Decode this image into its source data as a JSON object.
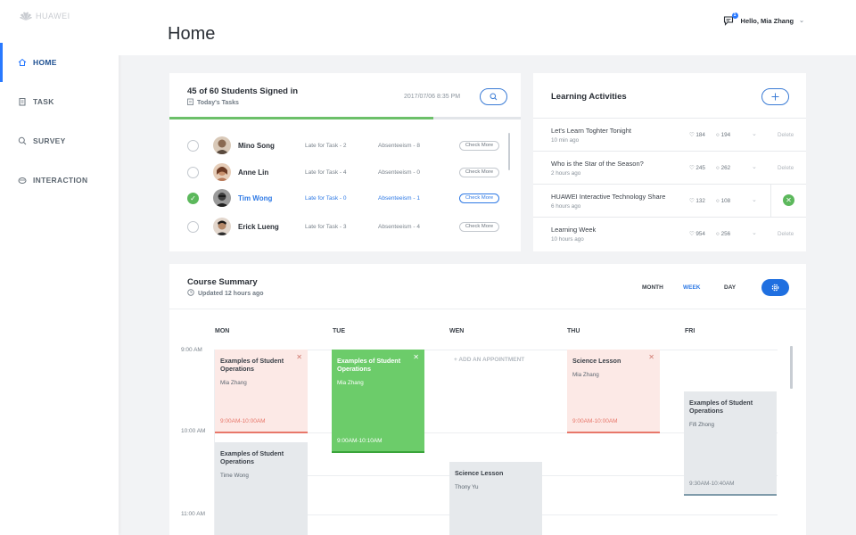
{
  "app": {
    "logo_text": "HUAWEI"
  },
  "sidebar": {
    "items": [
      {
        "label": "HOME",
        "icon": "home-icon"
      },
      {
        "label": "TASK",
        "icon": "task-icon"
      },
      {
        "label": "SURVEY",
        "icon": "survey-icon"
      },
      {
        "label": "INTERACTION",
        "icon": "interaction-icon"
      }
    ]
  },
  "header": {
    "title": "Home",
    "greeting": "Hello, Mia Zhang",
    "notifications": "1"
  },
  "students": {
    "title": "45 of 60 Students Signed in",
    "subtitle": "Today's Tasks",
    "datetime": "2017/07/06 8:35 PM",
    "progress": 0.75,
    "rows": [
      {
        "name": "Mino Song",
        "late": "Late for Task - 2",
        "absent": "Absenteeism - 8",
        "action": "Check More",
        "checked": false
      },
      {
        "name": "Anne Lin",
        "late": "Late for Task - 4",
        "absent": "Absenteeism - 0",
        "action": "Check More",
        "checked": false
      },
      {
        "name": "Tim Wong",
        "late": "Late for Task - 0",
        "absent": "Absenteeism - 1",
        "action": "Check More",
        "checked": true
      },
      {
        "name": "Erick Lueng",
        "late": "Late for Task - 3",
        "absent": "Absenteeism - 4",
        "action": "Check More",
        "checked": false
      }
    ]
  },
  "activities": {
    "title": "Learning Activities",
    "items": [
      {
        "title": "Let's Learn Toghter Tonight",
        "time": "10 min ago",
        "likes": "184",
        "comments": "194",
        "action": "Delete"
      },
      {
        "title": "Who is the Star of the Season?",
        "time": "2 hours ago",
        "likes": "245",
        "comments": "262",
        "action": "Delete"
      },
      {
        "title": "HUAWEI Interactive Technology Share",
        "time": "6 hours ago",
        "likes": "132",
        "comments": "108",
        "action": ""
      },
      {
        "title": "Learning Week",
        "time": "10 hours ago",
        "likes": "954",
        "comments": "256",
        "action": "Delete"
      }
    ]
  },
  "course": {
    "title": "Course Summary",
    "updated": "Updated 12 hours ago",
    "views": [
      "MONTH",
      "WEEK",
      "DAY"
    ],
    "active_view": "WEEK",
    "days": [
      "MON",
      "TUE",
      "WEN",
      "THU",
      "FRI"
    ],
    "times": [
      "9:00 AM",
      "10:00 AM",
      "11:00 AM"
    ],
    "add_label": "+ ADD AN APPOINTMENT",
    "events": [
      {
        "title": "Examples of Student Operations",
        "person": "Mia Zhang",
        "time": "9:00AM-10:00AM"
      },
      {
        "title": "Examples of Student Operations",
        "person": "Mia Zhang",
        "time": "9:00AM-10:10AM"
      },
      {
        "title": "Science Lesson",
        "person": "Mia Zhang",
        "time": "9:00AM-10:00AM"
      },
      {
        "title": "Examples of Student Operations",
        "person": "Fifi Zhong",
        "time": "9:30AM-10:40AM"
      },
      {
        "title": "Examples of Student Operations",
        "person": "Time Wong",
        "time": ""
      },
      {
        "title": "Science Lesson",
        "person": "Thony Yu",
        "time": ""
      }
    ]
  },
  "colors": {
    "accent": "#2979ff",
    "success": "#5cb85c",
    "danger": "#e8776a"
  }
}
